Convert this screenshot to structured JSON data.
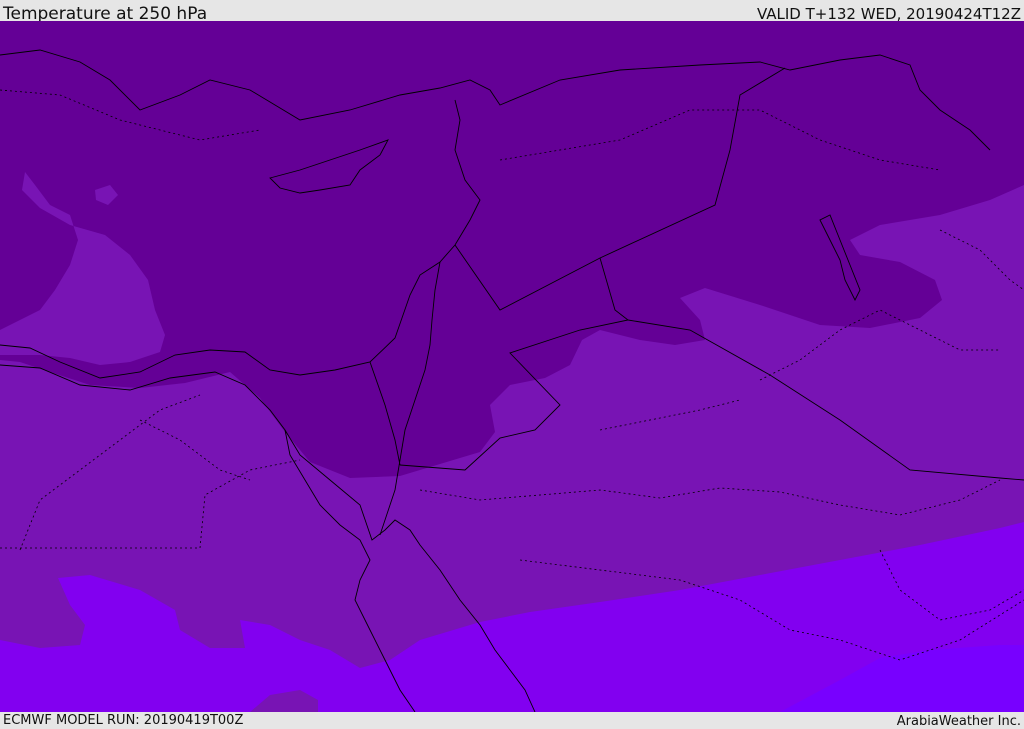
{
  "header": {
    "title": "Temperature at 250 hPa",
    "valid": "VALID T+132 WED, 20190424T12Z"
  },
  "footer": {
    "model_run": "ECMWF MODEL RUN: 20190419T00Z",
    "credit": "ArabiaWeather Inc."
  },
  "map": {
    "variable": "temperature",
    "level": "250 hPa",
    "shading_colors": [
      "#640096",
      "#7814b4",
      "#8200f0",
      "#7800ff"
    ],
    "line_color": "#000000"
  }
}
